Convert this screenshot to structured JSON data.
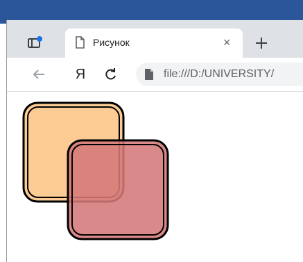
{
  "browser": {
    "tab": {
      "title": "Рисунок"
    },
    "toolbar": {
      "yandex_label": "Я",
      "address": "file:///D:/UNIVERSITY/"
    }
  },
  "drawing": {
    "shapes": [
      {
        "name": "orange square",
        "fill": "#fdcb94",
        "stroke": "#000000"
      },
      {
        "name": "red square",
        "fill": "#d5797a",
        "stroke": "#000000"
      }
    ]
  },
  "colors": {
    "window_frame": "#2b579a",
    "tab_strip": "#dee1e6",
    "omnibox": "#f1f3f4",
    "accent_dot": "#1a73e8"
  }
}
